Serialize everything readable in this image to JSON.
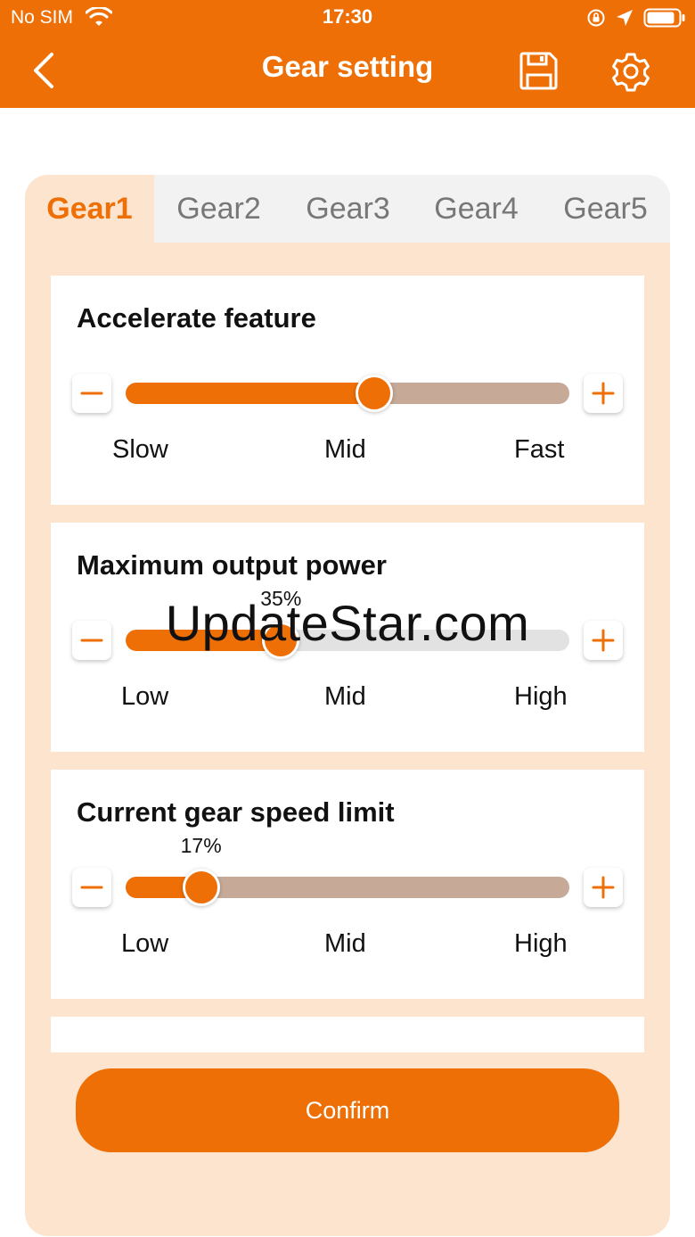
{
  "status_bar": {
    "carrier": "No SIM",
    "time": "17:30"
  },
  "nav": {
    "title": "Gear setting"
  },
  "tabs": [
    {
      "label": "Gear1",
      "active": true
    },
    {
      "label": "Gear2",
      "active": false
    },
    {
      "label": "Gear3",
      "active": false
    },
    {
      "label": "Gear4",
      "active": false
    },
    {
      "label": "Gear5",
      "active": false
    }
  ],
  "settings": [
    {
      "title": "Accelerate feature",
      "value_pct": 56,
      "value_label": "",
      "track_color": "#c6a996",
      "ticks": [
        "Slow",
        "Mid",
        "Fast"
      ]
    },
    {
      "title": "Maximum output power",
      "value_pct": 35,
      "value_label": "35%",
      "track_color": "#e2e2e2",
      "ticks": [
        "Low",
        "Mid",
        "High"
      ]
    },
    {
      "title": "Current gear speed limit",
      "value_pct": 17,
      "value_label": "17%",
      "track_color": "#c6a996",
      "ticks": [
        "Low",
        "Mid",
        "High"
      ]
    }
  ],
  "confirm_label": "Confirm",
  "watermark": "UpdateStar.com",
  "colors": {
    "accent": "#ee6f05",
    "panel_bg": "#fde4cf"
  }
}
